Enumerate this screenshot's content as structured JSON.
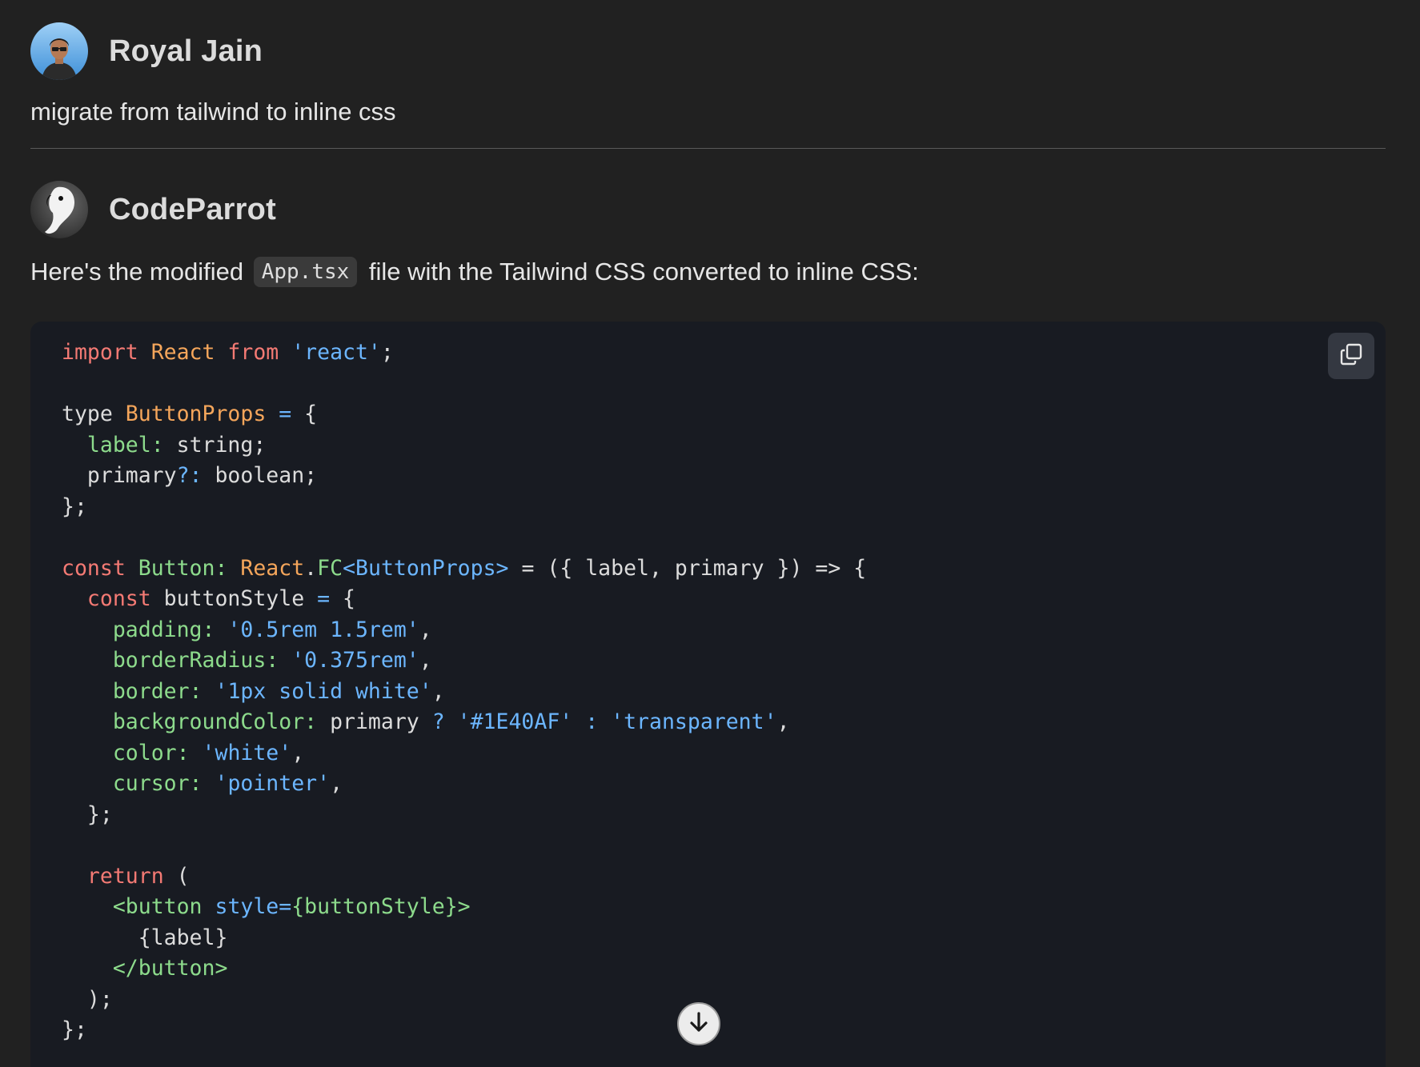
{
  "user_message": {
    "author": "Royal Jain",
    "text": "migrate from tailwind to inline css"
  },
  "assistant_message": {
    "author": "CodeParrot",
    "intro_before": "Here's the modified ",
    "intro_code": "App.tsx",
    "intro_after": " file with the Tailwind CSS converted to inline CSS:"
  },
  "code_block": {
    "copy_icon": "copy-icon",
    "lines": [
      "import React from 'react';",
      "",
      "type ButtonProps = {",
      "  label: string;",
      "  primary?: boolean;",
      "};",
      "",
      "const Button: React.FC<ButtonProps> = ({ label, primary }) => {",
      "  const buttonStyle = {",
      "    padding: '0.5rem 1.5rem',",
      "    borderRadius: '0.375rem',",
      "    border: '1px solid white',",
      "    backgroundColor: primary ? '#1E40AF' : 'transparent',",
      "    color: 'white',",
      "    cursor: 'pointer',",
      "  };",
      "",
      "  return (",
      "    <button style={buttonStyle}>",
      "      {label}",
      "    </button>",
      "  );",
      "};"
    ]
  },
  "scroll_button": {
    "icon": "arrow-down-icon"
  },
  "colors": {
    "background": "#212121",
    "code_background": "#181b22",
    "keyword": "#f47a74",
    "type": "#f5a65b",
    "string": "#6cb6ff",
    "property": "#8ddb8c"
  }
}
